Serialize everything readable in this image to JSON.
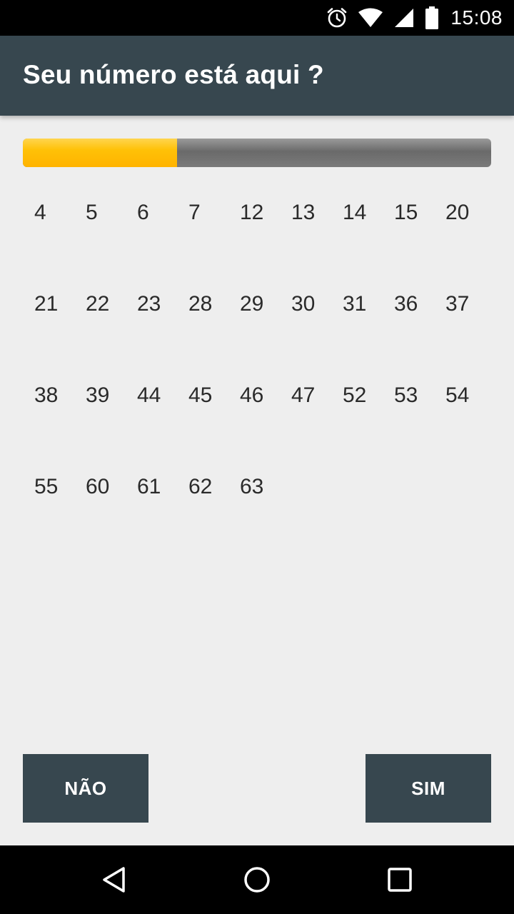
{
  "status_bar": {
    "time": "15:08",
    "icons": [
      "alarm-icon",
      "wifi-icon",
      "cell-signal-icon",
      "battery-icon"
    ]
  },
  "app_bar": {
    "title": "Seu número está aqui ?"
  },
  "progress": {
    "fraction": 0.33,
    "fill_color": "#ffc107",
    "track_color": "#757575"
  },
  "numbers": [
    "4",
    "5",
    "6",
    "7",
    "12",
    "13",
    "14",
    "15",
    "20",
    "21",
    "22",
    "23",
    "28",
    "29",
    "30",
    "31",
    "36",
    "37",
    "38",
    "39",
    "44",
    "45",
    "46",
    "47",
    "52",
    "53",
    "54",
    "55",
    "60",
    "61",
    "62",
    "63"
  ],
  "buttons": {
    "no_label": "NÃO",
    "yes_label": "SIM"
  },
  "nav_bar": {
    "icons": [
      "back-icon",
      "home-icon",
      "recents-icon"
    ]
  },
  "colors": {
    "primary": "#37474f",
    "background": "#eeeeee",
    "accent": "#ffc107"
  }
}
